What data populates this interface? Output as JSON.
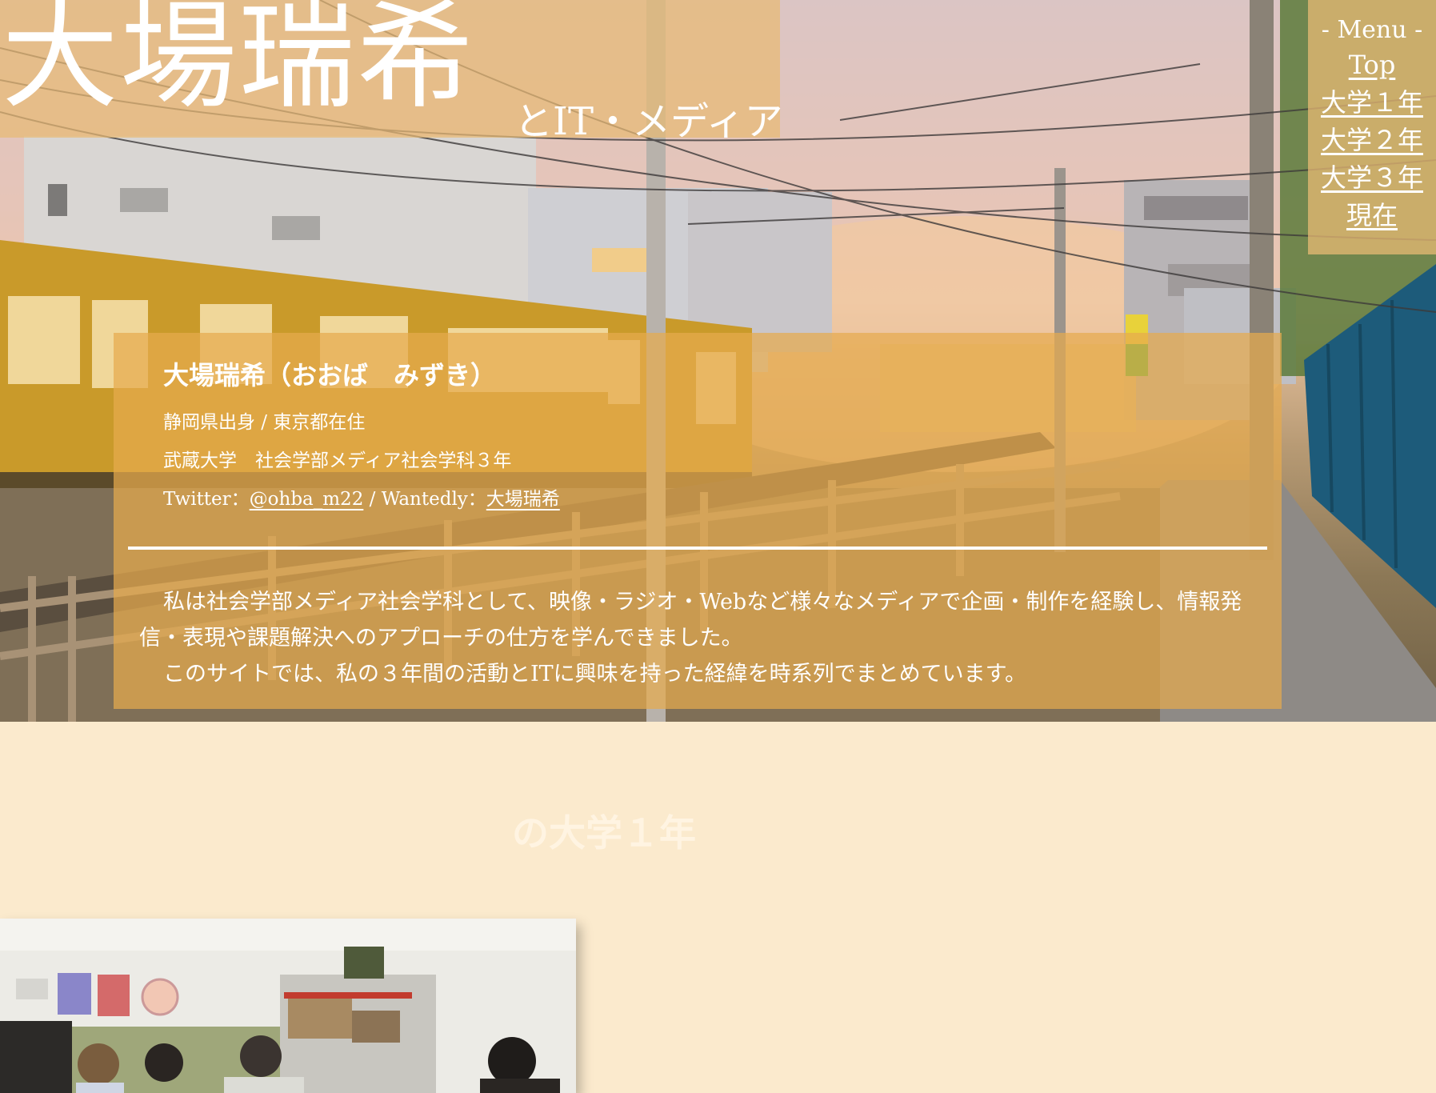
{
  "site": {
    "title_main": "大場瑞希",
    "title_sub": "とIT・メディア"
  },
  "menu": {
    "heading": "- Menu -",
    "items": [
      "Top",
      "大学１年",
      "大学２年",
      "大学３年",
      "現在"
    ]
  },
  "profile": {
    "name": "大場瑞希（おおば　みずき）",
    "origin": "静岡県出身 / 東京都在住",
    "school": "武蔵大学　社会学部メディア社会学科３年",
    "sns_prefix": "Twitter：",
    "twitter_handle": "@ohba_m22",
    "sns_separator": " / Wantedly：",
    "wantedly_name": "大場瑞希",
    "paragraph_1": "私は社会学部メディア社会学科として、映像・ラジオ・Webなど様々なメディアで企画・制作を経験し、情報発信・表現や課題解決へのアプローチの仕方を学んできました。",
    "paragraph_2": "このサイトでは、私の３年間の活動とITに興味を持った経緯を時系列でまとめています。"
  },
  "sections": {
    "year1_heading": "の大学１年"
  },
  "colors": {
    "page_background": "#fbeacd",
    "overlay_accent": "#e6aa4e",
    "text_on_overlay": "#ffffff"
  }
}
